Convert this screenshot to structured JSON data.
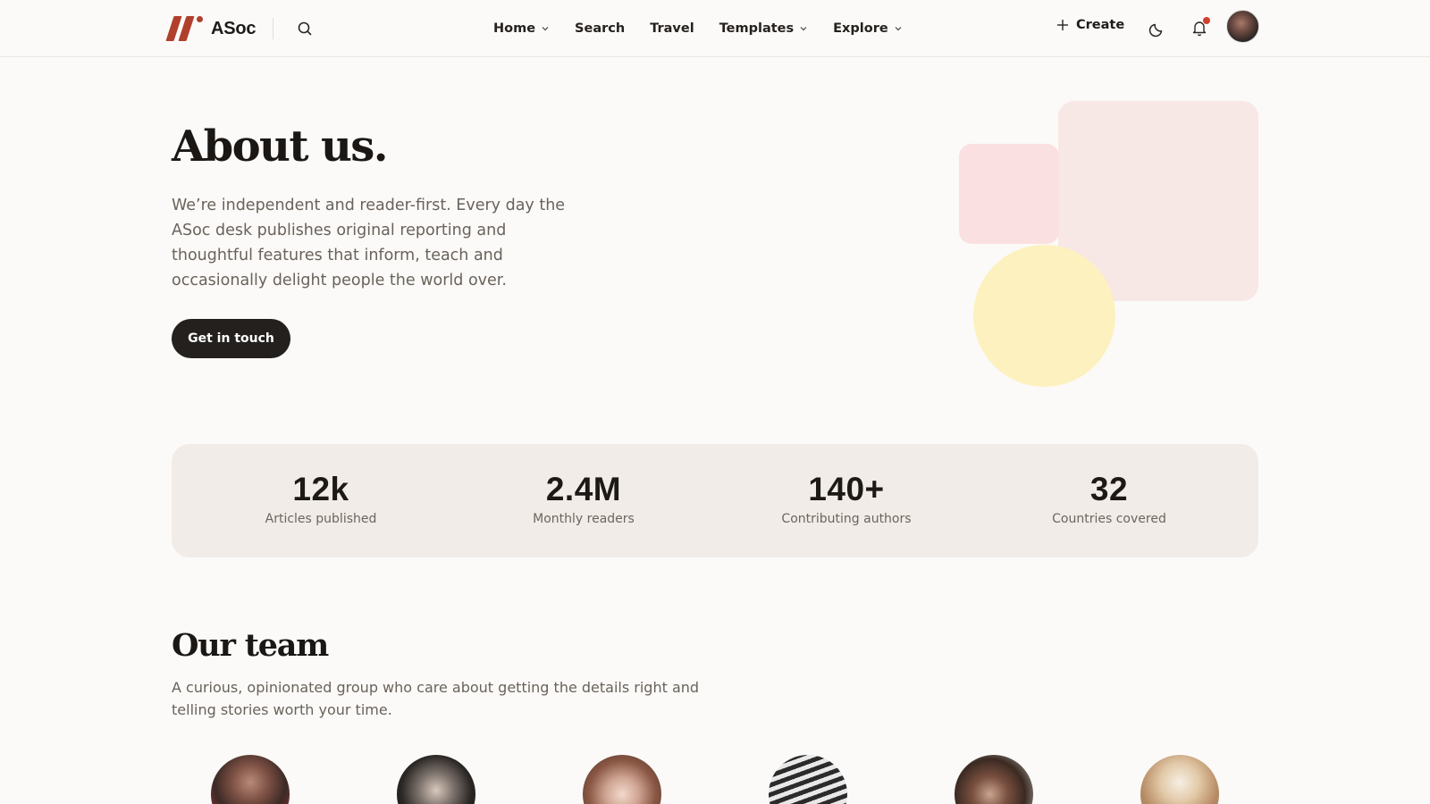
{
  "header": {
    "brand": "ASoc",
    "nav": [
      {
        "label": "Home",
        "has_dropdown": true
      },
      {
        "label": "Search",
        "has_dropdown": false
      },
      {
        "label": "Travel",
        "has_dropdown": false
      },
      {
        "label": "Templates",
        "has_dropdown": true
      },
      {
        "label": "Explore",
        "has_dropdown": true
      }
    ],
    "create_label": "Create",
    "icons": [
      "search-icon",
      "plus-icon",
      "moon-icon",
      "bell-icon",
      "avatar"
    ]
  },
  "hero": {
    "title": "About us.",
    "description": "We’re independent and reader-first. Every day the ASoc desk publishes original reporting and thoughtful features that inform, teach and occasionally delight people the world over.",
    "cta_label": "Get in touch"
  },
  "stats": [
    {
      "value": "12k",
      "label": "Articles published"
    },
    {
      "value": "2.4M",
      "label": "Monthly readers"
    },
    {
      "value": "140+",
      "label": "Contributing authors"
    },
    {
      "value": "32",
      "label": "Countries covered"
    }
  ],
  "team": {
    "title": "Our team",
    "description": "A curious, opinionated group who care about getting the details right and telling stories worth your time."
  },
  "colors": {
    "brand": "#b0402c",
    "background": "#fbfaf8",
    "button": "#24201d",
    "stats_bg": "#f1ece7",
    "shape_pink_light": "#f7e8e5",
    "shape_pink": "#fbe0e2",
    "shape_yellow": "#fdf1bf",
    "notification": "#d2402e"
  }
}
